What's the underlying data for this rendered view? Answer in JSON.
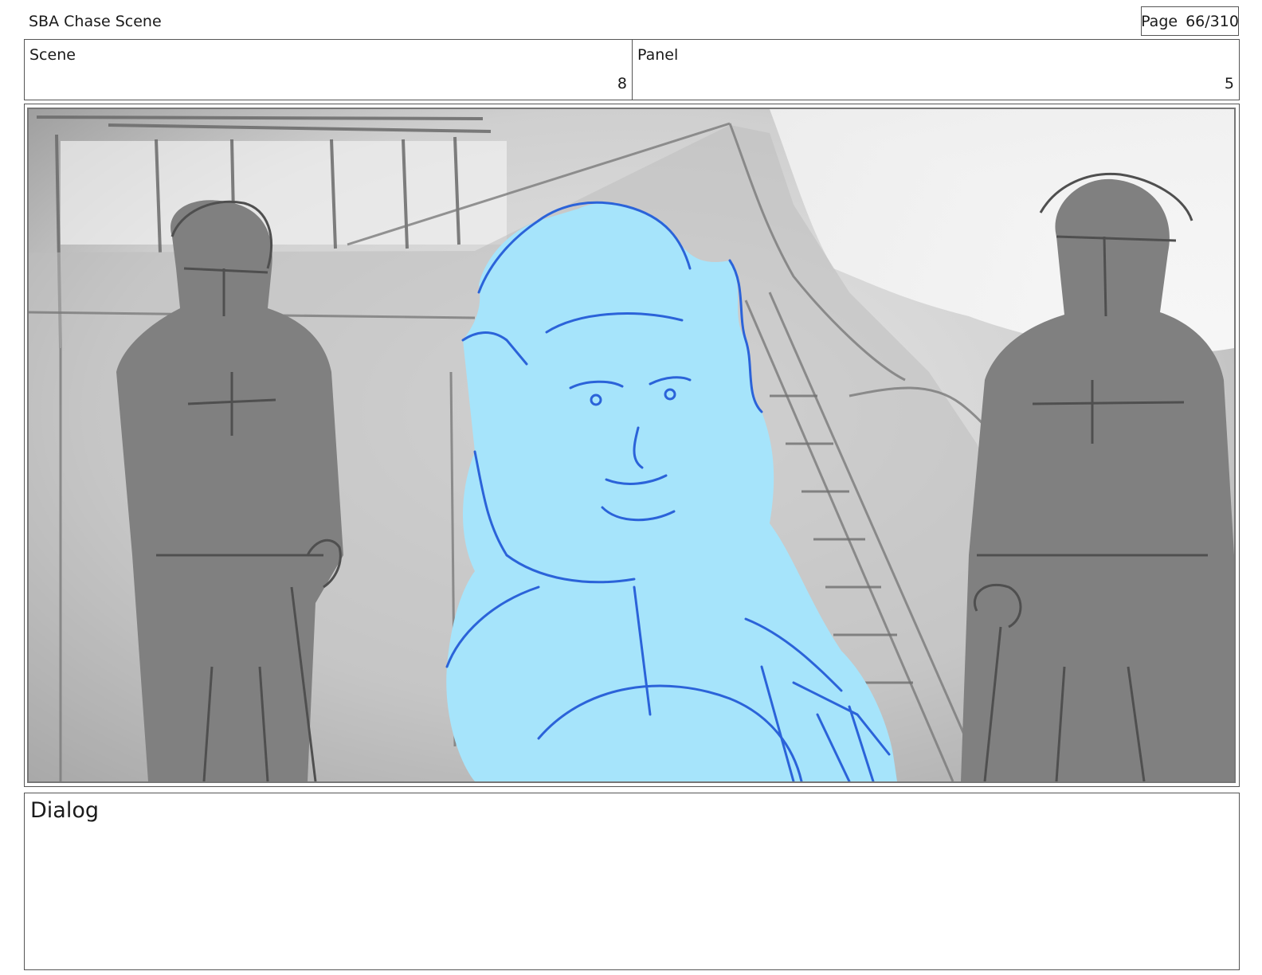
{
  "header": {
    "project_title": "SBA Chase Scene",
    "page_label": "Page",
    "page_number": "66/310"
  },
  "info": {
    "scene_label": "Scene",
    "scene_value": "8",
    "panel_label": "Panel",
    "panel_value": "5"
  },
  "frame": {
    "image_name": "storyboard-sketch",
    "colors": {
      "background": "#cfcfcf",
      "figure_gray": "#7f7f7f",
      "sketch_line": "#4d4d4d",
      "hero_fill": "#a6e4fb",
      "hero_line": "#2b63d9"
    }
  },
  "dialog": {
    "label": "Dialog"
  }
}
